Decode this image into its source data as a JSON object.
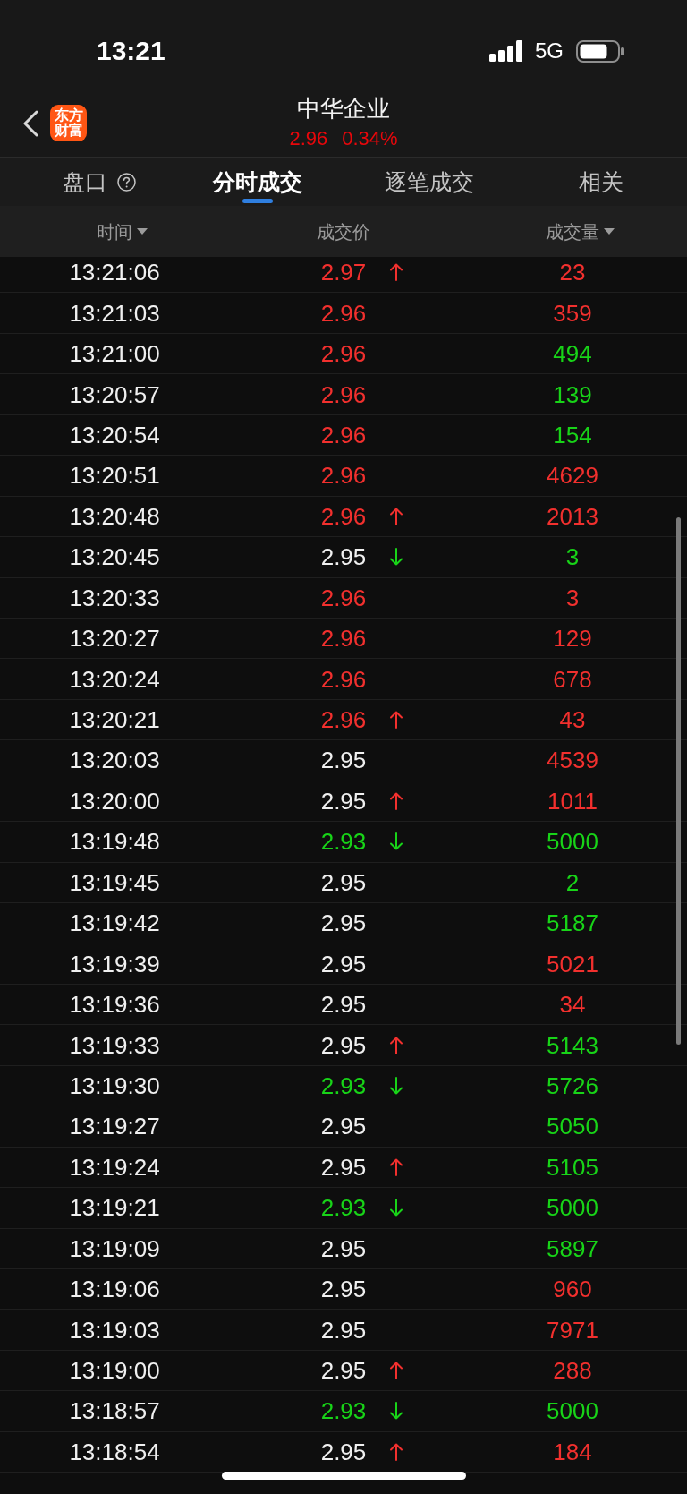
{
  "status_bar": {
    "time": "13:21",
    "network": "5G"
  },
  "header": {
    "logo": "东方财富",
    "title": "中华企业",
    "price": "2.96",
    "change": "0.34%",
    "rising": true
  },
  "tabs": [
    {
      "label": "盘口",
      "help": true,
      "selected": false
    },
    {
      "label": "分时成交",
      "help": false,
      "selected": true
    },
    {
      "label": "逐笔成交",
      "help": false,
      "selected": false
    },
    {
      "label": "相关",
      "help": false,
      "selected": false
    }
  ],
  "columns": [
    {
      "label": "时间",
      "sort_caret": true
    },
    {
      "label": "成交价",
      "sort_caret": false
    },
    {
      "label": "成交量",
      "sort_caret": true
    }
  ],
  "rows": [
    {
      "time": "13:21:06",
      "price": {
        "text": "2.97",
        "color": "#f2302e"
      },
      "up_arrow": true,
      "down_arrow": false,
      "volume": {
        "text": "23",
        "color": "#f2302e"
      }
    },
    {
      "time": "13:21:03",
      "price": {
        "text": "2.96",
        "color": "#f2302e"
      },
      "up_arrow": false,
      "down_arrow": false,
      "volume": {
        "text": "359",
        "color": "#f2302e"
      }
    },
    {
      "time": "13:21:00",
      "price": {
        "text": "2.96",
        "color": "#f2302e"
      },
      "up_arrow": false,
      "down_arrow": false,
      "volume": {
        "text": "494",
        "color": "#18d418"
      }
    },
    {
      "time": "13:20:57",
      "price": {
        "text": "2.96",
        "color": "#f2302e"
      },
      "up_arrow": false,
      "down_arrow": false,
      "volume": {
        "text": "139",
        "color": "#18d418"
      }
    },
    {
      "time": "13:20:54",
      "price": {
        "text": "2.96",
        "color": "#f2302e"
      },
      "up_arrow": false,
      "down_arrow": false,
      "volume": {
        "text": "154",
        "color": "#18d418"
      }
    },
    {
      "time": "13:20:51",
      "price": {
        "text": "2.96",
        "color": "#f2302e"
      },
      "up_arrow": false,
      "down_arrow": false,
      "volume": {
        "text": "4629",
        "color": "#f2302e"
      }
    },
    {
      "time": "13:20:48",
      "price": {
        "text": "2.96",
        "color": "#f2302e"
      },
      "up_arrow": true,
      "down_arrow": false,
      "volume": {
        "text": "2013",
        "color": "#f2302e"
      }
    },
    {
      "time": "13:20:45",
      "price": {
        "text": "2.95",
        "color": "#f0f0f0"
      },
      "up_arrow": false,
      "down_arrow": true,
      "volume": {
        "text": "3",
        "color": "#18d418"
      }
    },
    {
      "time": "13:20:33",
      "price": {
        "text": "2.96",
        "color": "#f2302e"
      },
      "up_arrow": false,
      "down_arrow": false,
      "volume": {
        "text": "3",
        "color": "#f2302e"
      }
    },
    {
      "time": "13:20:27",
      "price": {
        "text": "2.96",
        "color": "#f2302e"
      },
      "up_arrow": false,
      "down_arrow": false,
      "volume": {
        "text": "129",
        "color": "#f2302e"
      }
    },
    {
      "time": "13:20:24",
      "price": {
        "text": "2.96",
        "color": "#f2302e"
      },
      "up_arrow": false,
      "down_arrow": false,
      "volume": {
        "text": "678",
        "color": "#f2302e"
      }
    },
    {
      "time": "13:20:21",
      "price": {
        "text": "2.96",
        "color": "#f2302e"
      },
      "up_arrow": true,
      "down_arrow": false,
      "volume": {
        "text": "43",
        "color": "#f2302e"
      }
    },
    {
      "time": "13:20:03",
      "price": {
        "text": "2.95",
        "color": "#f0f0f0"
      },
      "up_arrow": false,
      "down_arrow": false,
      "volume": {
        "text": "4539",
        "color": "#f2302e"
      }
    },
    {
      "time": "13:20:00",
      "price": {
        "text": "2.95",
        "color": "#f0f0f0"
      },
      "up_arrow": true,
      "down_arrow": false,
      "volume": {
        "text": "1011",
        "color": "#f2302e"
      }
    },
    {
      "time": "13:19:48",
      "price": {
        "text": "2.93",
        "color": "#18d418"
      },
      "up_arrow": false,
      "down_arrow": true,
      "volume": {
        "text": "5000",
        "color": "#18d418"
      }
    },
    {
      "time": "13:19:45",
      "price": {
        "text": "2.95",
        "color": "#f0f0f0"
      },
      "up_arrow": false,
      "down_arrow": false,
      "volume": {
        "text": "2",
        "color": "#18d418"
      }
    },
    {
      "time": "13:19:42",
      "price": {
        "text": "2.95",
        "color": "#f0f0f0"
      },
      "up_arrow": false,
      "down_arrow": false,
      "volume": {
        "text": "5187",
        "color": "#18d418"
      }
    },
    {
      "time": "13:19:39",
      "price": {
        "text": "2.95",
        "color": "#f0f0f0"
      },
      "up_arrow": false,
      "down_arrow": false,
      "volume": {
        "text": "5021",
        "color": "#f2302e"
      }
    },
    {
      "time": "13:19:36",
      "price": {
        "text": "2.95",
        "color": "#f0f0f0"
      },
      "up_arrow": false,
      "down_arrow": false,
      "volume": {
        "text": "34",
        "color": "#f2302e"
      }
    },
    {
      "time": "13:19:33",
      "price": {
        "text": "2.95",
        "color": "#f0f0f0"
      },
      "up_arrow": true,
      "down_arrow": false,
      "volume": {
        "text": "5143",
        "color": "#18d418"
      }
    },
    {
      "time": "13:19:30",
      "price": {
        "text": "2.93",
        "color": "#18d418"
      },
      "up_arrow": false,
      "down_arrow": true,
      "volume": {
        "text": "5726",
        "color": "#18d418"
      }
    },
    {
      "time": "13:19:27",
      "price": {
        "text": "2.95",
        "color": "#f0f0f0"
      },
      "up_arrow": false,
      "down_arrow": false,
      "volume": {
        "text": "5050",
        "color": "#18d418"
      }
    },
    {
      "time": "13:19:24",
      "price": {
        "text": "2.95",
        "color": "#f0f0f0"
      },
      "up_arrow": true,
      "down_arrow": false,
      "volume": {
        "text": "5105",
        "color": "#18d418"
      }
    },
    {
      "time": "13:19:21",
      "price": {
        "text": "2.93",
        "color": "#18d418"
      },
      "up_arrow": false,
      "down_arrow": true,
      "volume": {
        "text": "5000",
        "color": "#18d418"
      }
    },
    {
      "time": "13:19:09",
      "price": {
        "text": "2.95",
        "color": "#f0f0f0"
      },
      "up_arrow": false,
      "down_arrow": false,
      "volume": {
        "text": "5897",
        "color": "#18d418"
      }
    },
    {
      "time": "13:19:06",
      "price": {
        "text": "2.95",
        "color": "#f0f0f0"
      },
      "up_arrow": false,
      "down_arrow": false,
      "volume": {
        "text": "960",
        "color": "#f2302e"
      }
    },
    {
      "time": "13:19:03",
      "price": {
        "text": "2.95",
        "color": "#f0f0f0"
      },
      "up_arrow": false,
      "down_arrow": false,
      "volume": {
        "text": "7971",
        "color": "#f2302e"
      }
    },
    {
      "time": "13:19:00",
      "price": {
        "text": "2.95",
        "color": "#f0f0f0"
      },
      "up_arrow": true,
      "down_arrow": false,
      "volume": {
        "text": "288",
        "color": "#f2302e"
      }
    },
    {
      "time": "13:18:57",
      "price": {
        "text": "2.93",
        "color": "#18d418"
      },
      "up_arrow": false,
      "down_arrow": true,
      "volume": {
        "text": "5000",
        "color": "#18d418"
      }
    },
    {
      "time": "13:18:54",
      "price": {
        "text": "2.95",
        "color": "#f0f0f0"
      },
      "up_arrow": true,
      "down_arrow": false,
      "volume": {
        "text": "184",
        "color": "#f2302e"
      }
    }
  ]
}
